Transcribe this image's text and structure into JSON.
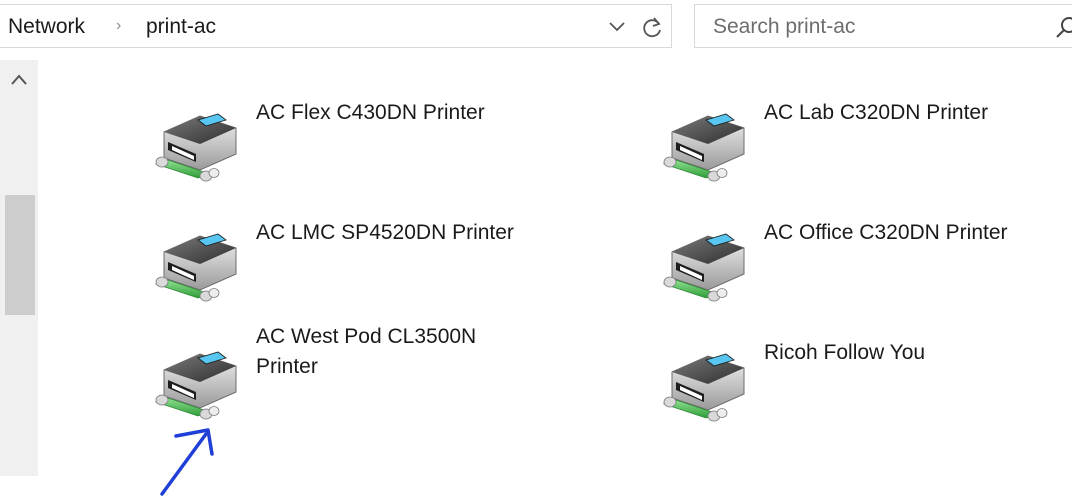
{
  "address_bar": {
    "breadcrumb": [
      "Network",
      "print-ac"
    ],
    "separator": "›"
  },
  "search": {
    "placeholder": "Search print-ac"
  },
  "items": [
    {
      "label": "AC Flex C430DN Printer",
      "icon": "network-printer-icon"
    },
    {
      "label": "AC Lab C320DN Printer",
      "icon": "network-printer-icon"
    },
    {
      "label": "AC LMC SP4520DN Printer",
      "icon": "network-printer-icon"
    },
    {
      "label": "AC Office C320DN Printer",
      "icon": "network-printer-icon"
    },
    {
      "label": "AC West Pod CL3500N Printer",
      "icon": "network-printer-icon"
    },
    {
      "label": "Ricoh Follow You",
      "icon": "network-printer-icon"
    }
  ],
  "colors": {
    "annotation": "#1f3fd6",
    "printer_cable": "#3bb54a",
    "scrollbar_thumb": "#cdcdcd"
  }
}
